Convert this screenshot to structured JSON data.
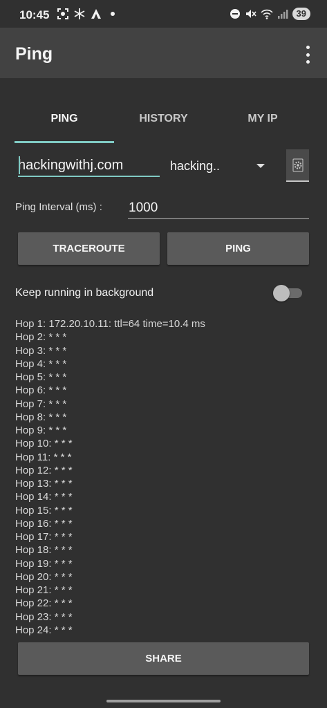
{
  "status_bar": {
    "time": "10:45",
    "battery": "39",
    "left_icons": [
      "screenshot-icon",
      "snowflake-icon",
      "vpn-icon",
      "dot-icon"
    ],
    "right_icons": [
      "dnd-icon",
      "mute-icon",
      "wifi-icon",
      "signal-icon"
    ]
  },
  "app_bar": {
    "title": "Ping"
  },
  "tabs": [
    {
      "label": "PING",
      "active": true
    },
    {
      "label": "HISTORY",
      "active": false
    },
    {
      "label": "MY IP",
      "active": false
    }
  ],
  "host": {
    "value": "hackingwithj.com",
    "select_value": "hacking.."
  },
  "interval": {
    "label": "Ping Interval (ms) :",
    "value": "1000"
  },
  "buttons": {
    "traceroute": "TRACEROUTE",
    "ping": "PING",
    "share": "SHARE"
  },
  "background": {
    "label": "Keep running in background",
    "enabled": false
  },
  "output": [
    "Hop 1: 172.20.10.11: ttl=64 time=10.4 ms",
    "Hop 2: * * *",
    "Hop 3: * * *",
    "Hop 4: * * *",
    "Hop 5: * * *",
    "Hop 6: * * *",
    "Hop 7: * * *",
    "Hop 8: * * *",
    "Hop 9: * * *",
    "Hop 10: * * *",
    "Hop 11: * * *",
    "Hop 12: * * *",
    "Hop 13: * * *",
    "Hop 14: * * *",
    "Hop 15: * * *",
    "Hop 16: * * *",
    "Hop 17: * * *",
    "Hop 18: * * *",
    "Hop 19: * * *",
    "Hop 20: * * *",
    "Hop 21: * * *",
    "Hop 22: * * *",
    "Hop 23: * * *",
    "Hop 24: * * *"
  ],
  "colors": {
    "accent": "#80cbc4",
    "background": "#303030",
    "app_bar": "#424242",
    "button": "#5a5a5a"
  }
}
